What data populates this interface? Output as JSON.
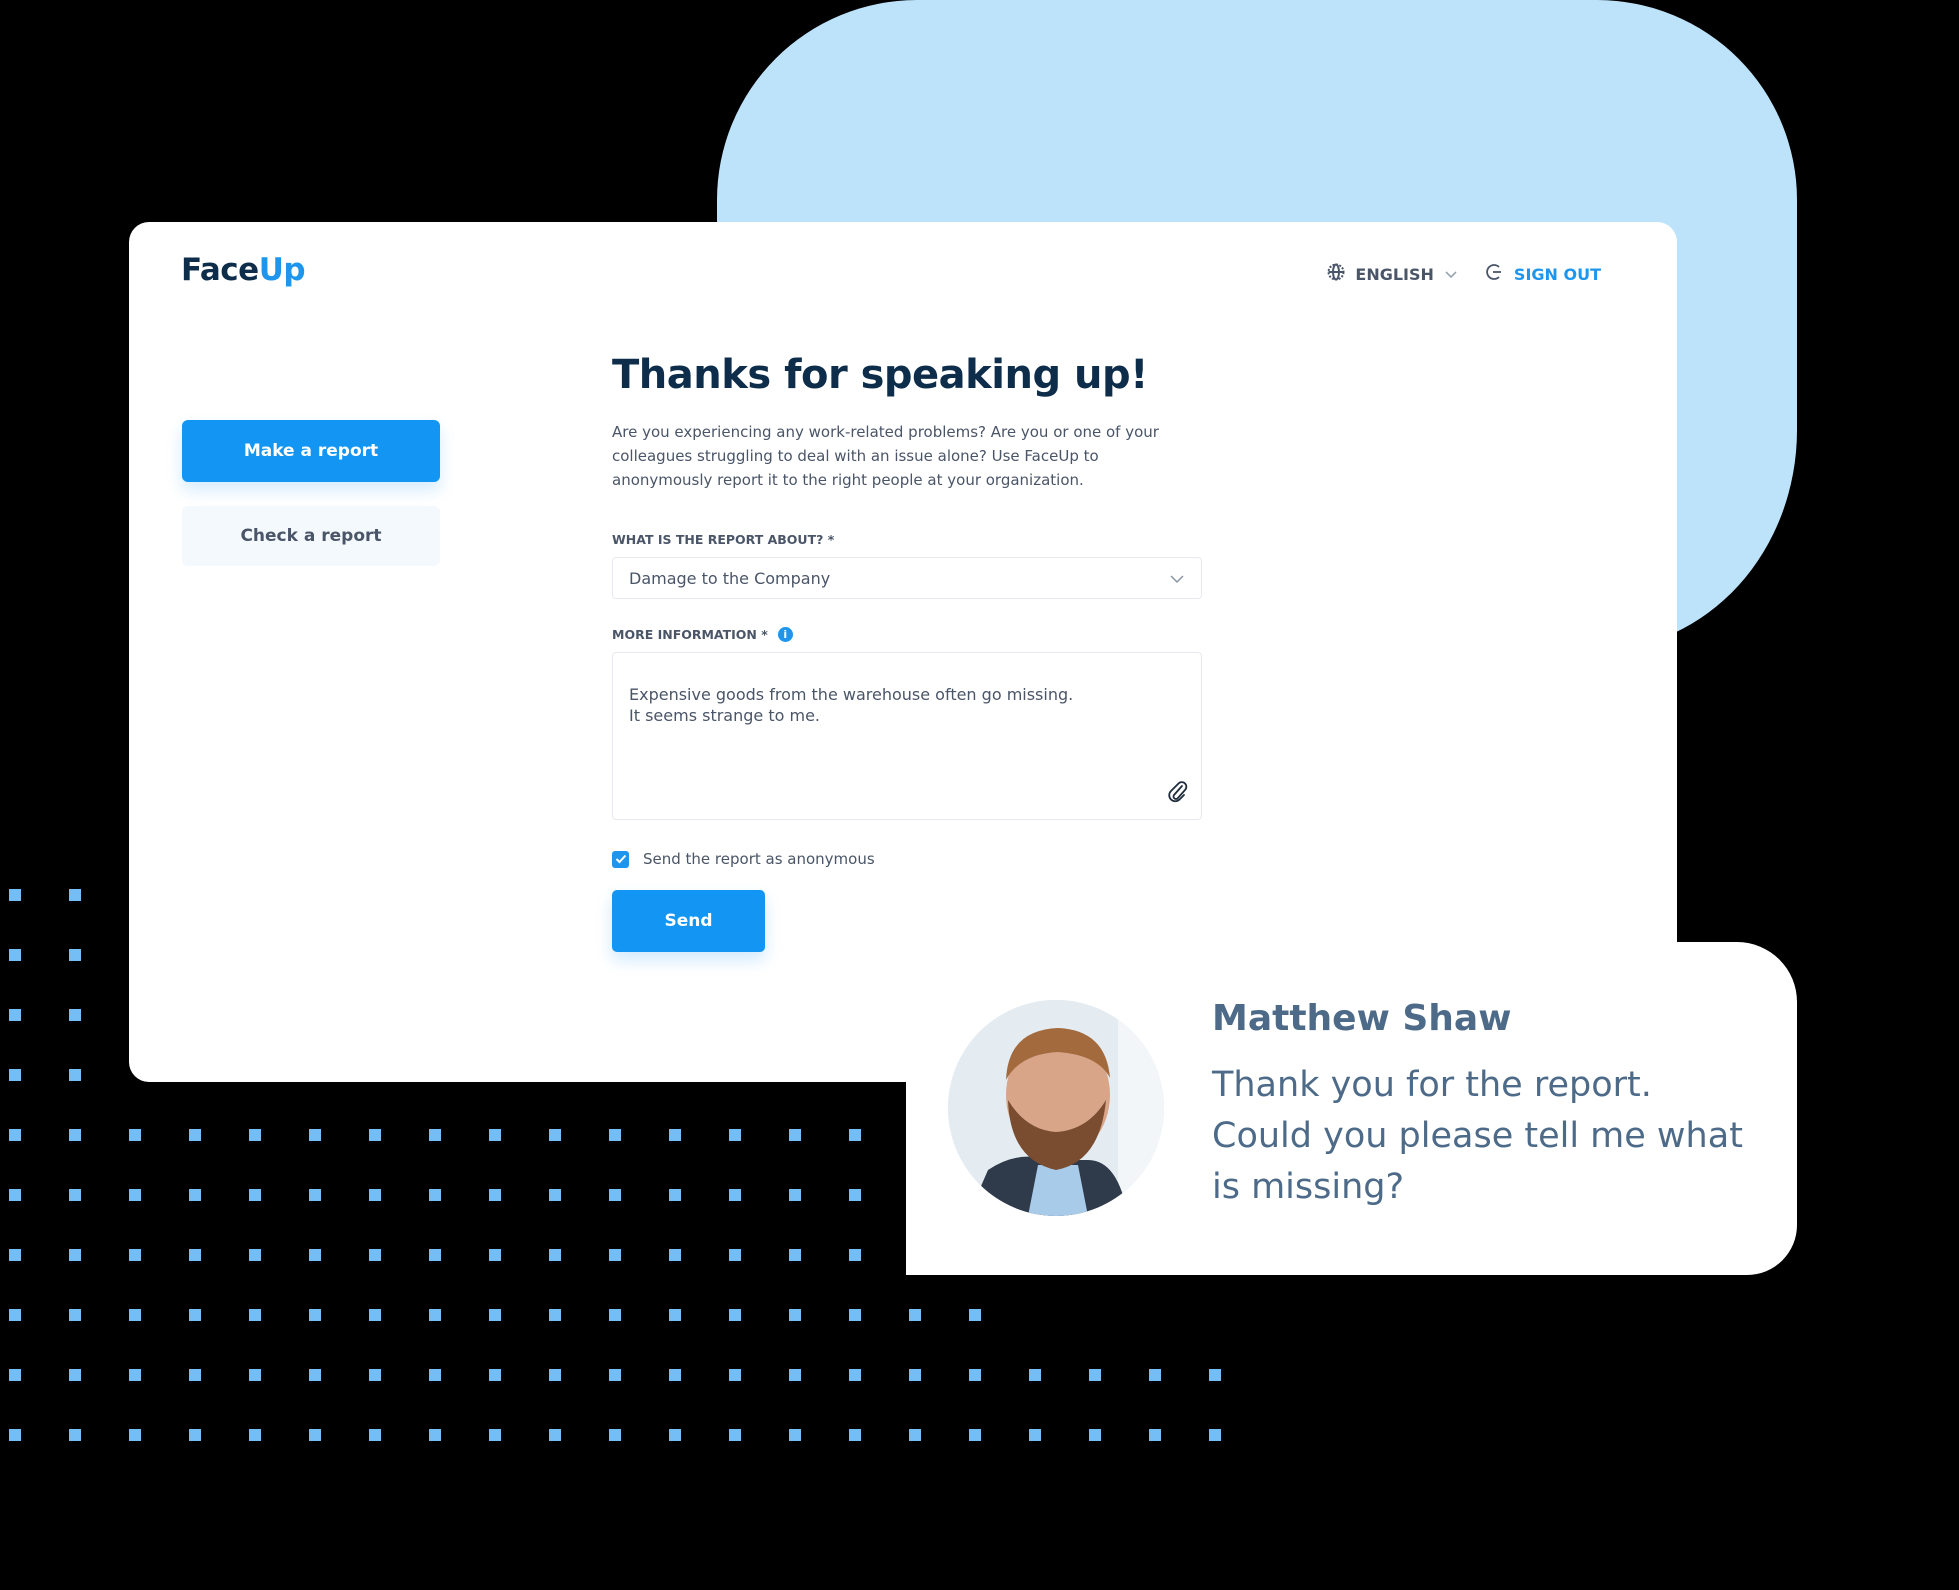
{
  "app": {
    "logo_text_a": "Face",
    "logo_text_b": "Up",
    "accent": "#1396f3",
    "background_shape_color": "#bde3fb",
    "dots_color": "#74bdf5"
  },
  "header": {
    "language_label": "ENGLISH",
    "language_icon": "globe-icon",
    "sign_out_label": "SIGN OUT",
    "sign_out_icon": "sign-out-icon"
  },
  "sidebar": {
    "make_report_label": "Make a report",
    "check_report_label": "Check a report"
  },
  "form": {
    "title": "Thanks for speaking up!",
    "intro": "Are you experiencing any work-related problems? Are you or one of your colleagues struggling to deal with an issue alone? Use FaceUp to anonymously report it to the right people at your organization.",
    "topic_label": "WHAT IS THE REPORT ABOUT? *",
    "topic_value": "Damage to the Company",
    "info_label": "MORE INFORMATION *",
    "info_value": "Expensive goods from the warehouse often go missing.\nIt seems strange to me.",
    "anonymous_label": "Send the report as anonymous",
    "anonymous_checked": true,
    "send_label": "Send"
  },
  "chat": {
    "name": "Matthew Shaw",
    "message": "Thank you for the report. Could you please tell me what is missing?"
  }
}
